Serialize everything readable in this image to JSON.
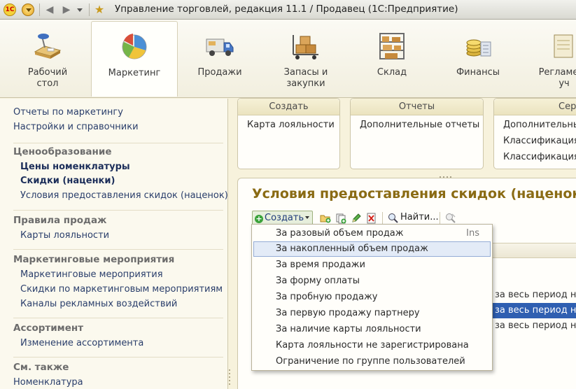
{
  "window": {
    "title": "Управление торговлей, редакция 11.1 / Продавец (1С:Предприятие)",
    "logo_text": "1С"
  },
  "sections": [
    {
      "label": "Рабочий\nстол",
      "icon": "desk-lamp-icon"
    },
    {
      "label": "Маркетинг",
      "icon": "pie-chart-icon",
      "active": true
    },
    {
      "label": "Продажи",
      "icon": "truck-icon"
    },
    {
      "label": "Запасы и\nзакупки",
      "icon": "boxes-cart-icon"
    },
    {
      "label": "Склад",
      "icon": "warehouse-shelves-icon"
    },
    {
      "label": "Финансы",
      "icon": "coins-icon"
    },
    {
      "label": "Регламент\nуч",
      "icon": "regulations-icon"
    }
  ],
  "leftnav": {
    "top_links": [
      "Отчеты по маркетингу",
      "Настройки и справочники"
    ],
    "groups": [
      {
        "head": "Ценообразование",
        "links": [
          "Цены номенклатуры",
          "Скидки (наценки)",
          "Условия предоставления скидок (наценок)"
        ]
      },
      {
        "head": "Правила продаж",
        "links": [
          "Карты лояльности"
        ]
      },
      {
        "head": "Маркетинговые мероприятия",
        "links": [
          "Маркетинговые мероприятия",
          "Скидки по маркетинговым мероприятиям",
          "Каналы рекламных воздействий"
        ]
      },
      {
        "head": "Ассортимент",
        "links": [
          "Изменение ассортимента"
        ]
      },
      {
        "head": "См. также",
        "links": [
          "Номенклатура"
        ]
      }
    ]
  },
  "actions": [
    {
      "head": "Создать",
      "items": [
        "Карта лояльности"
      ]
    },
    {
      "head": "Отчеты",
      "items": [
        "Дополнительные отчеты"
      ]
    },
    {
      "head": "Сер",
      "items": [
        "Дополнительны",
        "Классификация",
        "Классификация"
      ]
    }
  ],
  "form": {
    "title": "Условия предоставления скидок (наценок)",
    "create_label": "Создать",
    "find_label": "Найти..."
  },
  "table_rows": [
    "за весь период не",
    "за весь период не",
    "за весь период не"
  ],
  "dropdown": {
    "items": [
      {
        "label": "За разовый объем продаж",
        "shortcut": "Ins"
      },
      {
        "label": "За накопленный объем продаж",
        "hover": true
      },
      {
        "label": "За время продажи"
      },
      {
        "label": "За форму оплаты"
      },
      {
        "label": "За пробную продажу"
      },
      {
        "label": "За первую продажу партнеру"
      },
      {
        "label": "За наличие карты лояльности"
      },
      {
        "label": "Карта лояльности не зарегистрирована"
      },
      {
        "label": "Ограничение по группе пользователей"
      }
    ]
  }
}
